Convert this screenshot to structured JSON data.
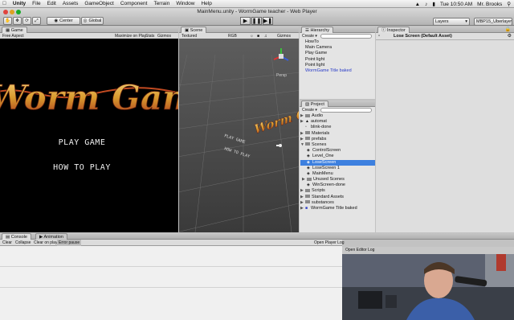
{
  "menubar": {
    "apple_icon": "apple-icon",
    "app_name": "Unity",
    "items": [
      "File",
      "Edit",
      "Assets",
      "GameObject",
      "Component",
      "Terrain",
      "Window",
      "Help"
    ],
    "clock": "Tue 10:50 AM",
    "user": "Mr. Brooks"
  },
  "window": {
    "title": "MainMenu.unity - WormGame teacher - Web Player"
  },
  "toolbar": {
    "center_label": "Center",
    "global_label": "Global",
    "layers_label": "Layers",
    "layout_label": "MBP15_Uberlaye"
  },
  "game": {
    "tab_label": "Game",
    "aspect_label": "Free Aspect",
    "maximize_label": "Maximize on Play",
    "stats_label": "Stats",
    "gizmos_label": "Gizmos",
    "title_art": "Worm Game",
    "play_label": "PLAY GAME",
    "howto_label": "HOW TO PLAY"
  },
  "scene": {
    "tab_label": "Scene",
    "textured_label": "Textured",
    "rgb_label": "RGB",
    "gizmos_label": "Gizmos",
    "persp_label": "Persp",
    "title_art": "Worm Game",
    "play_label": "PLAY GAME",
    "howto_label": "HOW TO PLAY"
  },
  "hierarchy": {
    "tab_label": "Hierarchy",
    "create_label": "Create",
    "items": [
      {
        "label": "HowTo",
        "blue": false
      },
      {
        "label": "Main Camera",
        "blue": false
      },
      {
        "label": "Play Game",
        "blue": false
      },
      {
        "label": "Point light",
        "blue": false
      },
      {
        "label": "Point light",
        "blue": false
      },
      {
        "label": "WormGame Title baked",
        "blue": true
      }
    ]
  },
  "project": {
    "tab_label": "Project",
    "create_label": "Create",
    "items": [
      {
        "label": "Audio",
        "kind": "folder",
        "depth": 0,
        "selected": false
      },
      {
        "label": "automat",
        "kind": "anim",
        "depth": 0,
        "selected": false
      },
      {
        "label": "blink-done",
        "kind": "file",
        "depth": 0,
        "selected": false
      },
      {
        "label": "Materials",
        "kind": "folder",
        "depth": 0,
        "selected": false
      },
      {
        "label": "prefabs",
        "kind": "folder",
        "depth": 0,
        "selected": false
      },
      {
        "label": "Scenes",
        "kind": "folder-open",
        "depth": 0,
        "selected": false
      },
      {
        "label": "ControlScreen",
        "kind": "scene",
        "depth": 1,
        "selected": false
      },
      {
        "label": "Level_One",
        "kind": "scene",
        "depth": 1,
        "selected": false
      },
      {
        "label": "LoseScreen",
        "kind": "scene",
        "depth": 1,
        "selected": true
      },
      {
        "label": "LoseScreen 1",
        "kind": "scene",
        "depth": 1,
        "selected": false
      },
      {
        "label": "MainMenu",
        "kind": "scene",
        "depth": 1,
        "selected": false
      },
      {
        "label": "Unused Scenes",
        "kind": "folder",
        "depth": 1,
        "selected": false
      },
      {
        "label": "WinScreen-done",
        "kind": "scene",
        "depth": 1,
        "selected": false
      },
      {
        "label": "Scripts",
        "kind": "folder",
        "depth": 0,
        "selected": false
      },
      {
        "label": "Standard Assets",
        "kind": "folder",
        "depth": 0,
        "selected": false
      },
      {
        "label": "substances",
        "kind": "folder",
        "depth": 0,
        "selected": false
      },
      {
        "label": "WormGame Title baked",
        "kind": "prefab",
        "depth": 0,
        "selected": false
      }
    ]
  },
  "inspector": {
    "tab_label": "Inspector",
    "object_label": "Lose Screen (Default Asset)"
  },
  "console": {
    "tab_label": "Console",
    "animation_tab_label": "Animation",
    "clear_label": "Clear",
    "collapse_label": "Collapse",
    "clear_on_play_label": "Clear on play",
    "error_pause_label": "Error pause",
    "open_player_log_label": "Open Player Log",
    "open_editor_log_label": "Open Editor Log"
  },
  "colors": {
    "selection": "#3d80df",
    "title_gold": "#e7b04a",
    "title_red": "#b8321e"
  }
}
